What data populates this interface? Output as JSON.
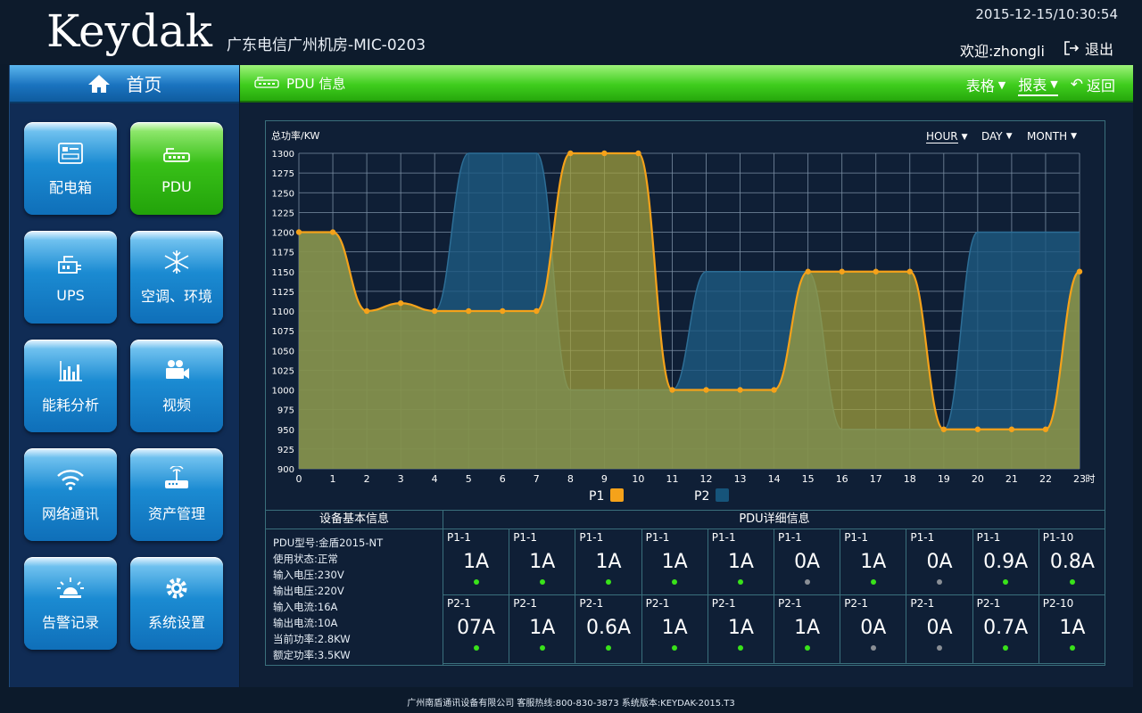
{
  "header": {
    "logo": "Keydak",
    "site_title": "广东电信广州机房-MIC-0203",
    "datetime": "2015-12-15/10:30:54",
    "welcome": "欢迎:zhongli",
    "logout": "退出"
  },
  "nav": {
    "home": "首页",
    "items": [
      {
        "label": "配电箱",
        "icon": "distribution-box-icon"
      },
      {
        "label": "PDU",
        "icon": "pdu-icon",
        "active": true
      },
      {
        "label": "UPS",
        "icon": "ups-icon"
      },
      {
        "label": "空调、环境",
        "icon": "snowflake-icon"
      },
      {
        "label": "能耗分析",
        "icon": "bar-chart-icon"
      },
      {
        "label": "视频",
        "icon": "video-camera-icon"
      },
      {
        "label": "网络通讯",
        "icon": "wifi-icon"
      },
      {
        "label": "资产管理",
        "icon": "router-icon"
      },
      {
        "label": "告警记录",
        "icon": "alarm-light-icon"
      },
      {
        "label": "系统设置",
        "icon": "gear-icon"
      }
    ]
  },
  "panel": {
    "title": "PDU 信息",
    "table": "表格",
    "report": "报表",
    "back": "返回"
  },
  "range": {
    "hour": "HOUR",
    "day": "DAY",
    "month": "MONTH"
  },
  "colors": {
    "p1": "#f5a21a",
    "p2": "#16547a",
    "accent_green": "#3fcd1e",
    "accent_blue": "#1a73bf"
  },
  "chart_data": {
    "type": "area",
    "ylabel": "总功率/KW",
    "xlabel": "时",
    "x": [
      0,
      1,
      2,
      3,
      4,
      5,
      6,
      7,
      8,
      9,
      10,
      11,
      12,
      13,
      14,
      15,
      16,
      17,
      18,
      19,
      20,
      21,
      22,
      23
    ],
    "ylim": [
      900,
      1300
    ],
    "yticks": [
      900,
      925,
      950,
      975,
      1000,
      1025,
      1050,
      1075,
      1100,
      1125,
      1150,
      1175,
      1200,
      1225,
      1250,
      1275,
      1300
    ],
    "grid": true,
    "legend": "bottom",
    "series": [
      {
        "name": "P1",
        "values": [
          1200,
          1200,
          1100,
          1110,
          1100,
          1100,
          1100,
          1100,
          1300,
          1300,
          1300,
          1000,
          1000,
          1000,
          1000,
          1150,
          1150,
          1150,
          1150,
          950,
          950,
          950,
          950,
          1150
        ]
      },
      {
        "name": "P2",
        "values": [
          1200,
          1200,
          1100,
          1100,
          1100,
          1300,
          1300,
          1300,
          1000,
          1000,
          1000,
          1000,
          1150,
          1150,
          1150,
          1150,
          950,
          950,
          950,
          950,
          1200,
          1200,
          1200,
          1200
        ]
      }
    ]
  },
  "basic_info": {
    "title": "设备基本信息",
    "lines": [
      "PDU型号:金盾2015-NT",
      "使用状态:正常",
      "输入电压:230V",
      "输出电压:220V",
      "输入电流:16A",
      "输出电流:10A",
      "当前功率:2.8KW",
      "额定功率:3.5KW"
    ]
  },
  "pdu_detail": {
    "title": "PDU详细信息",
    "cells": [
      {
        "name": "P1-1",
        "value": "1A",
        "on": true
      },
      {
        "name": "P1-1",
        "value": "1A",
        "on": true
      },
      {
        "name": "P1-1",
        "value": "1A",
        "on": true
      },
      {
        "name": "P1-1",
        "value": "1A",
        "on": true
      },
      {
        "name": "P1-1",
        "value": "1A",
        "on": true
      },
      {
        "name": "P1-1",
        "value": "0A",
        "on": false
      },
      {
        "name": "P1-1",
        "value": "1A",
        "on": true
      },
      {
        "name": "P1-1",
        "value": "0A",
        "on": false
      },
      {
        "name": "P1-1",
        "value": "0.9A",
        "on": true
      },
      {
        "name": "P1-10",
        "value": "0.8A",
        "on": true
      },
      {
        "name": "P2-1",
        "value": "07A",
        "on": true
      },
      {
        "name": "P2-1",
        "value": "1A",
        "on": true
      },
      {
        "name": "P2-1",
        "value": "0.6A",
        "on": true
      },
      {
        "name": "P2-1",
        "value": "1A",
        "on": true
      },
      {
        "name": "P2-1",
        "value": "1A",
        "on": true
      },
      {
        "name": "P2-1",
        "value": "1A",
        "on": true
      },
      {
        "name": "P2-1",
        "value": "0A",
        "on": false
      },
      {
        "name": "P2-1",
        "value": "0A",
        "on": false
      },
      {
        "name": "P2-1",
        "value": "0.7A",
        "on": true
      },
      {
        "name": "P2-10",
        "value": "1A",
        "on": true
      }
    ]
  },
  "footer": "广州南盾通讯设备有限公司 客服热线:800-830-3873 系统版本:KEYDAK-2015.T3"
}
